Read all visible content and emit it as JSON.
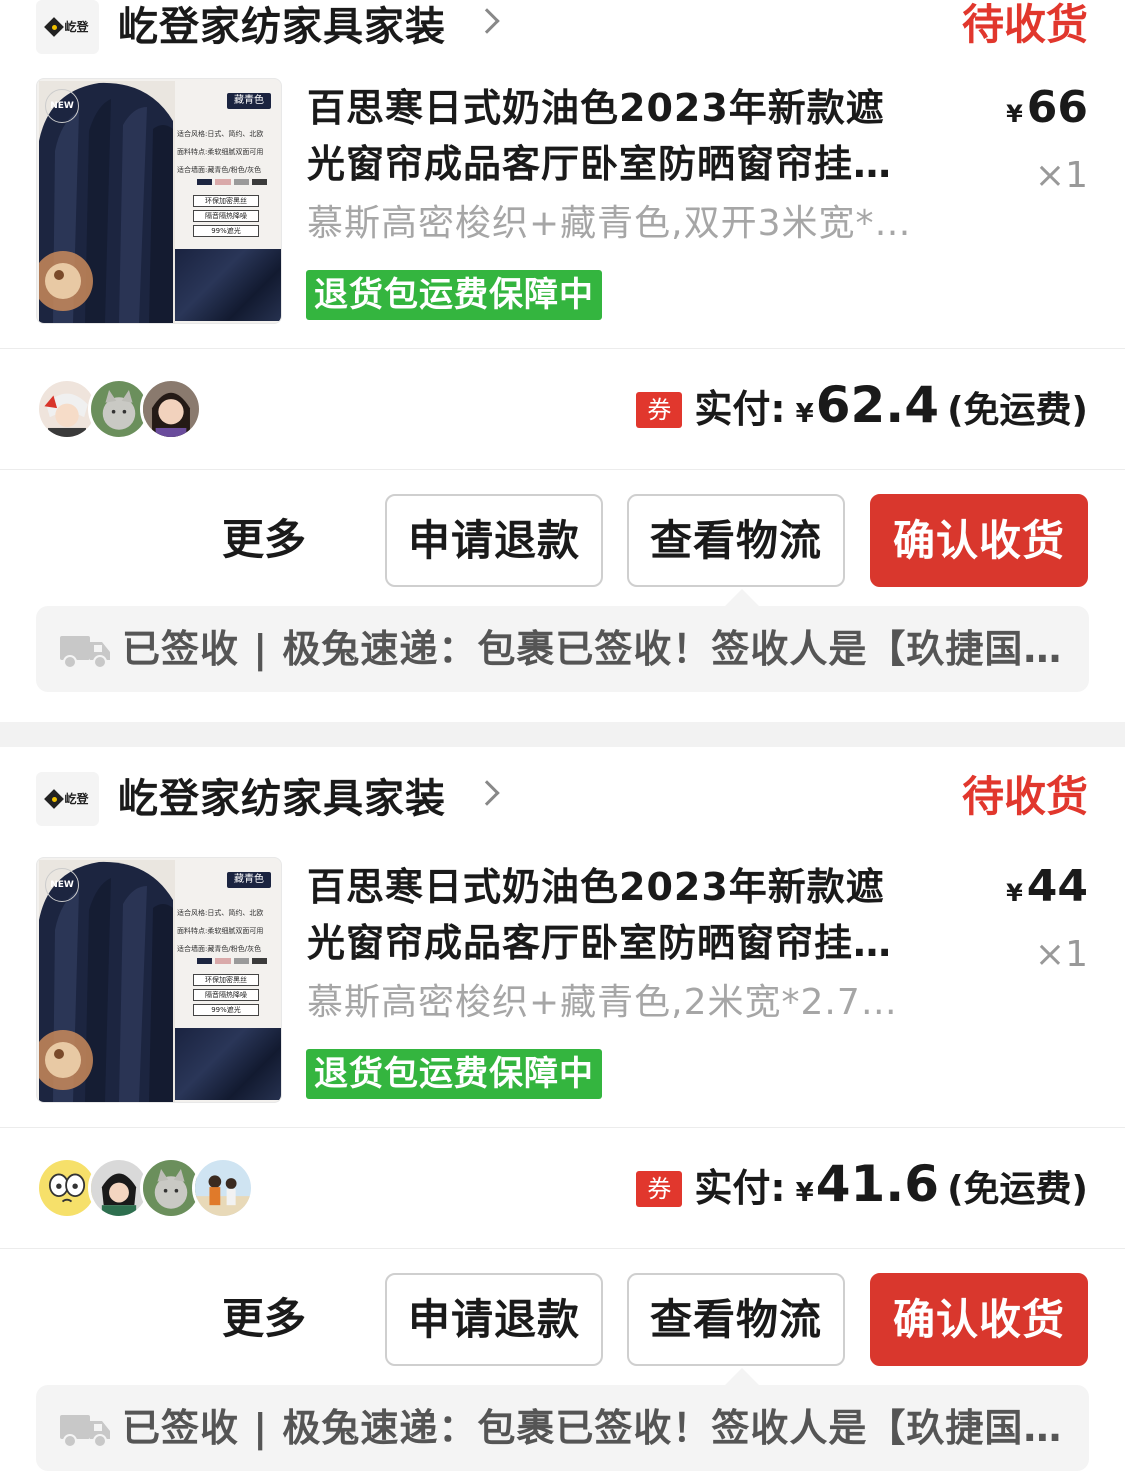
{
  "orders": [
    {
      "shop_name": "屹登家纺家具家装",
      "status": "待收货",
      "product": {
        "title_line1": "百思寒日式奶油色2023年新款遮",
        "title_line2": "光窗帘成品客厅卧室防晒窗帘挂…",
        "spec": "慕斯高密梭织+藏青色,双开3米宽*…",
        "guarantee": "退货包运费保障中",
        "price": "66",
        "qty": "×1"
      },
      "payment": {
        "label": "实付:",
        "currency": "¥",
        "amount": "62.4",
        "shipping": "(免运费)",
        "coupon_icon_text": "券"
      },
      "actions": {
        "more": "更多",
        "refund": "申请退款",
        "logistics": "查看物流",
        "confirm": "确认收货"
      },
      "logistics_text": "已签收 | 极兔速递：包裹已签收！签收人是【玖捷国…"
    },
    {
      "shop_name": "屹登家纺家具家装",
      "status": "待收货",
      "product": {
        "title_line1": "百思寒日式奶油色2023年新款遮",
        "title_line2": "光窗帘成品客厅卧室防晒窗帘挂…",
        "spec": "慕斯高密梭织+藏青色,2米宽*2.7…",
        "guarantee": "退货包运费保障中",
        "price": "44",
        "qty": "×1"
      },
      "payment": {
        "label": "实付:",
        "currency": "¥",
        "amount": "41.6",
        "shipping": "(免运费)",
        "coupon_icon_text": "券"
      },
      "actions": {
        "more": "更多",
        "refund": "申请退款",
        "logistics": "查看物流",
        "confirm": "确认收货"
      },
      "logistics_text": "已签收 | 极兔速递：包裹已签收！签收人是【玖捷国…"
    }
  ],
  "thumbnail": {
    "new_badge": "NEW",
    "tag": "藏青色",
    "features": [
      "环保加密黑丝",
      "隔音隔热降噪",
      "99%遮光"
    ],
    "lines": [
      "适合风格:日式、简约、北欧",
      "面料特点:柔软细腻双面可用",
      "适合墙面:藏青色/粉色/灰色"
    ]
  },
  "logo_text": "屹登",
  "colors": {
    "accent_red": "#e1372d",
    "guarantee_green": "#34b53f",
    "confirm_button": "#d9372d"
  },
  "icons": [
    "shop-logo-icon",
    "chevron-right-icon",
    "coupon-icon",
    "truck-icon"
  ]
}
